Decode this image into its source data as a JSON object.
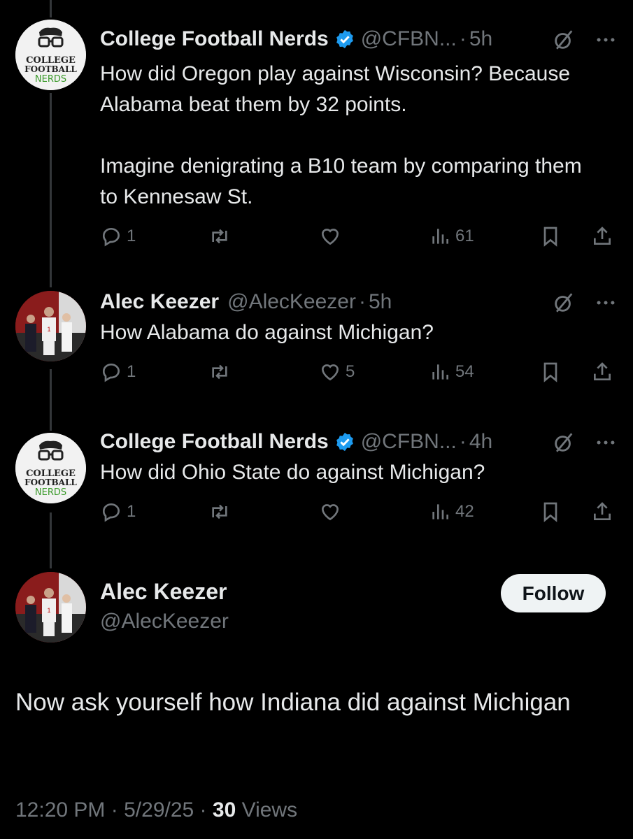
{
  "colors": {
    "background": "#000000",
    "text": "#e7e9ea",
    "muted": "#71767b",
    "verified": "#1d9bf0",
    "follow_bg": "#eff3f4"
  },
  "avatars": {
    "cfbn_logo_lines": [
      "COLLEGE",
      "FOOTBALL",
      "NERDS"
    ]
  },
  "tweets": [
    {
      "name": "College Football Nerds",
      "verified": true,
      "handle": "@CFBN...",
      "dot": "·",
      "time": "5h",
      "text": "How did Oregon play against Wisconsin? Because Alabama beat them by 32 points.\n\nImagine denigrating a B10 team by comparing them to Kennesaw St.",
      "replies": "1",
      "retweets": "",
      "likes": "",
      "views": "61"
    },
    {
      "name": "Alec Keezer",
      "verified": false,
      "handle": "@AlecKeezer",
      "dot": "·",
      "time": "5h",
      "text": "How Alabama do against Michigan?",
      "replies": "1",
      "retweets": "",
      "likes": "5",
      "views": "54"
    },
    {
      "name": "College Football Nerds",
      "verified": true,
      "handle": "@CFBN...",
      "dot": "·",
      "time": "4h",
      "text": "How did Ohio State do against Michigan?",
      "replies": "1",
      "retweets": "",
      "likes": "",
      "views": "42"
    }
  ],
  "main_tweet": {
    "name": "Alec Keezer",
    "handle": "@AlecKeezer",
    "follow_label": "Follow",
    "text": "Now ask yourself how Indiana did against Michigan",
    "time": "12:20 PM",
    "sep1": "·",
    "date": "5/29/25",
    "sep2": "·",
    "views_count": "30",
    "views_label": "Views"
  }
}
